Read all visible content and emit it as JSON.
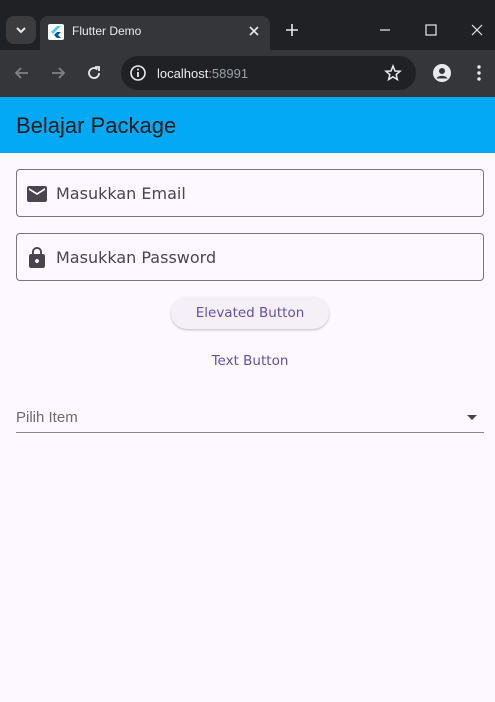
{
  "browser": {
    "tab": {
      "title": "Flutter Demo"
    },
    "address": {
      "host": "localhost",
      "port": ":58991"
    }
  },
  "app": {
    "title": "Belajar Package",
    "email": {
      "placeholder": "Masukkan Email",
      "value": ""
    },
    "password": {
      "placeholder": "Masukkan Password",
      "value": ""
    },
    "elevated_button_label": "Elevated Button",
    "text_button_label": "Text Button",
    "dropdown": {
      "hint": "Pilih Item"
    }
  },
  "colors": {
    "appbar": "#03a9f4",
    "background": "#fdf7ff",
    "button_text": "#6750a4"
  },
  "icons": [
    "tab-search-icon",
    "flutter-logo-icon",
    "close-icon",
    "plus-icon",
    "minimize-icon",
    "maximize-icon",
    "window-close-icon",
    "back-arrow-icon",
    "forward-arrow-icon",
    "reload-icon",
    "site-info-icon",
    "star-icon",
    "profile-icon",
    "more-vert-icon",
    "email-icon",
    "lock-icon",
    "dropdown-arrow-icon"
  ]
}
